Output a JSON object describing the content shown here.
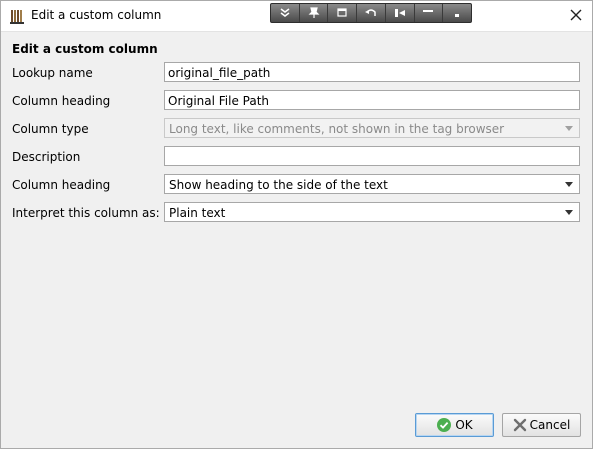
{
  "window": {
    "title": "Edit a custom column"
  },
  "form": {
    "heading": "Edit a custom column",
    "lookup_name": {
      "label": "Lookup name",
      "value": "original_file_path"
    },
    "column_heading": {
      "label": "Column heading",
      "value": "Original File Path"
    },
    "column_type": {
      "label": "Column type",
      "value": "Long text, like comments, not shown in the tag browser"
    },
    "description": {
      "label": "Description",
      "value": ""
    },
    "heading_position": {
      "label": "Column heading",
      "value": "Show heading to the side of the text"
    },
    "interpret": {
      "label": "Interpret this column as:",
      "value": "Plain text"
    }
  },
  "buttons": {
    "ok": "OK",
    "cancel": "Cancel"
  },
  "icons": {
    "app": "calibre-books-icon",
    "close": "close-icon",
    "ok": "check-icon",
    "cancel": "cross-icon"
  }
}
